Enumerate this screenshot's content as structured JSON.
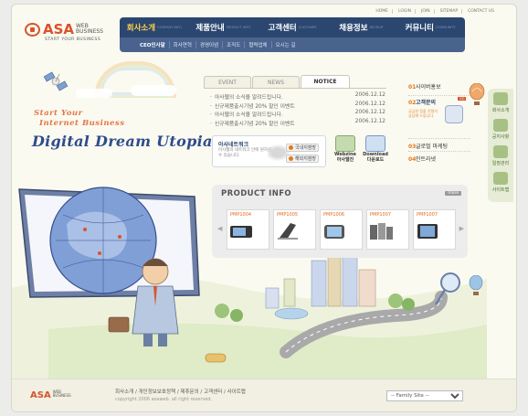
{
  "brand": {
    "name": "ASA",
    "sub": "WEB BUSINESS",
    "slogan": "START YOUR BUSINESS"
  },
  "util_nav": [
    "HOME",
    "LOGIN",
    "JOIN",
    "SITEMAP",
    "CONTACT US"
  ],
  "main_nav": [
    {
      "label": "회사소개",
      "en": "COMPANY INFO",
      "active": true
    },
    {
      "label": "제품안내",
      "en": "PRODUCT INFO",
      "active": false
    },
    {
      "label": "고객센터",
      "en": "CUSTOMER",
      "active": false
    },
    {
      "label": "채용정보",
      "en": "RECRUIT",
      "active": false
    },
    {
      "label": "커뮤니티",
      "en": "COMMUNITY",
      "active": false
    }
  ],
  "sub_nav": [
    "CEO인사말",
    "회사연혁",
    "경영이념",
    "조직도",
    "협력업체",
    "오시는 길"
  ],
  "hero": {
    "line1": "Start Your",
    "line2": "Internet Business",
    "headline": "Digital Dream Utopia!"
  },
  "board": {
    "tabs": [
      "EVENT",
      "NEWS",
      "NOTICE"
    ],
    "active_tab": "NOTICE",
    "items": [
      {
        "title": "아사웹의 소식을 알려드립니다.",
        "date": "2006.12.12"
      },
      {
        "title": "신규제품출시기념 20% 할인 이벤트",
        "date": "2006.12.12"
      },
      {
        "title": "아사웹의 소식을 알려드립니다.",
        "date": "2006.12.12"
      },
      {
        "title": "신규제품출시기념 20% 할인 이벤트",
        "date": "2006.12.12"
      }
    ]
  },
  "network": {
    "title": "아사네트워크",
    "desc": "아사웹의 네트워크 안에 원하실 수 있습니다.",
    "btn_domestic": "국내지점망",
    "btn_overseas": "해외지점망"
  },
  "webzine": "Webzine 아사웹진",
  "download": "Download 다운로드",
  "quick_menu": [
    {
      "num": "01",
      "label": "사이버홍보"
    },
    {
      "num": "02",
      "label": "고객문의",
      "help": "궁금한 점을 친절히 상담해 드립니다.",
      "badge": "GO"
    },
    {
      "num": "03",
      "label": "글로벌 마케팅"
    },
    {
      "num": "04",
      "label": "인트라넷"
    }
  ],
  "side_menu": [
    "회사소개",
    "공지사항",
    "일정관리",
    "사이트맵"
  ],
  "product": {
    "title": "PRODUCT INFO",
    "more": "more",
    "items": [
      {
        "code": "PMP1004"
      },
      {
        "code": "PMP1005"
      },
      {
        "code": "PMP1006"
      },
      {
        "code": "PMP1007"
      },
      {
        "code": "PMP1007"
      }
    ]
  },
  "footer": {
    "links": "회사소개 / 개인정보보호정책 / 제휴문의 / 고객센터 / 사이트맵",
    "copyright": "copyright 2006 asaweb. all right reserved.",
    "family_site": "-- Family Site --"
  }
}
